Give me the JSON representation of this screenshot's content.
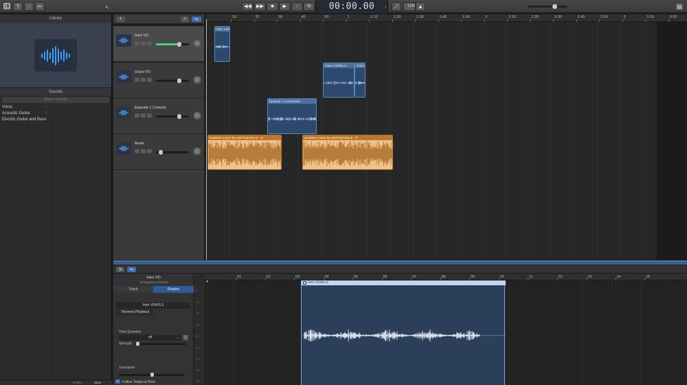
{
  "transport": {
    "lcd": "00:00.00"
  },
  "toolbar": {
    "count_in": "♩1234"
  },
  "library": {
    "title": "Library",
    "sounds_label": "Sounds",
    "search_placeholder": "Search Sounds",
    "categories": [
      "Voice",
      "Acoustic Guitar",
      "Electric Guitar and Bass"
    ],
    "footer_left": "Delete",
    "footer_right": "Save"
  },
  "tracks": [
    {
      "name": "Intro VO",
      "volume": 0.7,
      "selected": true
    },
    {
      "name": "Outro VO",
      "volume": 0.7,
      "selected": false
    },
    {
      "name": "Episode 1 Content",
      "volume": 0.7,
      "selected": false
    },
    {
      "name": "Music",
      "volume": 0.15,
      "selected": false
    }
  ],
  "ruler": [
    "10",
    "20",
    "30",
    "40",
    "50",
    "1",
    "1:10",
    "1:20",
    "1:30",
    "1:40",
    "1:50",
    "2",
    "2:10",
    "2:20",
    "2:30",
    "2:40",
    "2:50",
    "3",
    "3:10",
    "3:20"
  ],
  "regions": {
    "intro": "Intro VO#",
    "outro1": "Outro VO#01.5",
    "outro2": "Outro",
    "episode": "Episode 1 Content#01",
    "music1": "Southern Lover by Ariel Ramirez 5 - ⟲",
    "music2": "Southern Lover by Ariel Ramirez 5 - ⟲"
  },
  "editor": {
    "track_name": "Intro VO",
    "subtitle": "All Regions selected",
    "tab_track": "Track",
    "tab_region": "Region",
    "region_name": "Intro VO#01.5",
    "reverse_playback": "Reverse Playback",
    "time_quantize": "Time Quantize",
    "quantize_value": "off",
    "strength": "Strength",
    "transpose": "Transpose",
    "follow_tempo": "Follow Tempo & Pitch",
    "region_label": "Intro VO#01.5",
    "ruler": [
      "01",
      "02",
      "03",
      "04",
      "05",
      "06",
      "07",
      "08",
      "09",
      "10",
      "11",
      "12",
      "13",
      "14",
      "15"
    ],
    "db_scale": [
      "-6",
      "-15",
      "-29",
      "-35",
      "-61",
      "-12",
      "-29",
      "-32",
      "-35"
    ]
  },
  "colors": {
    "accent": "#3a5f8e",
    "region_blue": "#2d4a6e",
    "region_orange": "#efc28a",
    "volume_green": "#55d06a"
  }
}
